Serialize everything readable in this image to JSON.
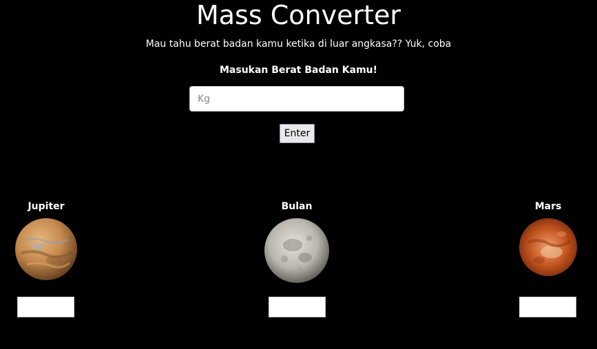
{
  "header": {
    "title": "Mass Converter",
    "subtitle": "Mau tahu berat badan kamu ketika di luar angkasa?? Yuk, coba",
    "prompt": "Masukan Berat Badan Kamu!"
  },
  "form": {
    "weight_value": "",
    "weight_placeholder": "Kg",
    "enter_label": "Enter"
  },
  "planets": [
    {
      "name": "Jupiter",
      "result": "",
      "colors": {
        "base": "#c48a4e",
        "light": "#e8b57c",
        "dark": "#7a4f2a"
      }
    },
    {
      "name": "Bulan",
      "result": "",
      "colors": {
        "base": "#b8b6ae",
        "light": "#e3e1d8",
        "dark": "#6e6c65"
      }
    },
    {
      "name": "Mars",
      "result": "",
      "colors": {
        "base": "#c2541e",
        "light": "#f0a070",
        "dark": "#7a2a0c"
      }
    }
  ],
  "colors": {
    "background": "#000000",
    "text": "#ffffff"
  }
}
